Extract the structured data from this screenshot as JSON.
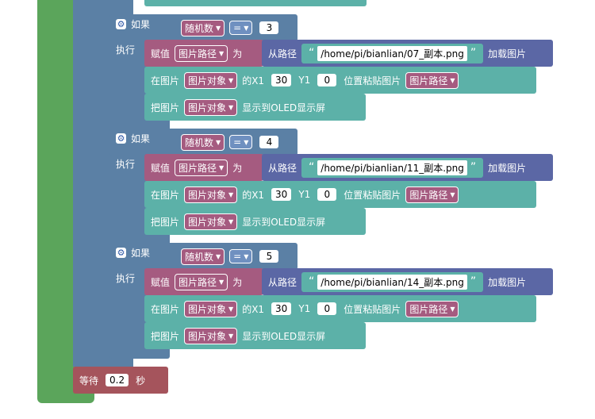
{
  "labels": {
    "if": "如果",
    "do": "执行",
    "assign": "赋值",
    "to": "为",
    "from_path": "从路径",
    "load_image": "加载图片",
    "in_image": "在图片",
    "at_x1": "的X1",
    "y1": "Y1",
    "paste_at": "位置粘贴图片",
    "put_image": "把图片",
    "show_oled": "显示到OLED显示屏",
    "wait": "等待",
    "seconds": "秒",
    "var_random": "随机数",
    "var_path": "图片路径",
    "var_obj": "图片对象",
    "op_eq": "="
  },
  "blocks": [
    {
      "compare": "3",
      "path": "/home/pi/bianlian/07_副本.png",
      "x1": "30",
      "y1": "0"
    },
    {
      "compare": "4",
      "path": "/home/pi/bianlian/11_副本.png",
      "x1": "30",
      "y1": "0"
    },
    {
      "compare": "5",
      "path": "/home/pi/bianlian/14_副本.png",
      "x1": "30",
      "y1": "0"
    }
  ],
  "wait": {
    "value": "0.2"
  },
  "colors": {
    "loop_green": "#5ba55b",
    "logic_blue": "#5b80a5",
    "variable_pink": "#a55b80",
    "image_teal": "#5cb1a8",
    "load_purple": "#5b67a5",
    "wait_red": "#a5545c"
  }
}
